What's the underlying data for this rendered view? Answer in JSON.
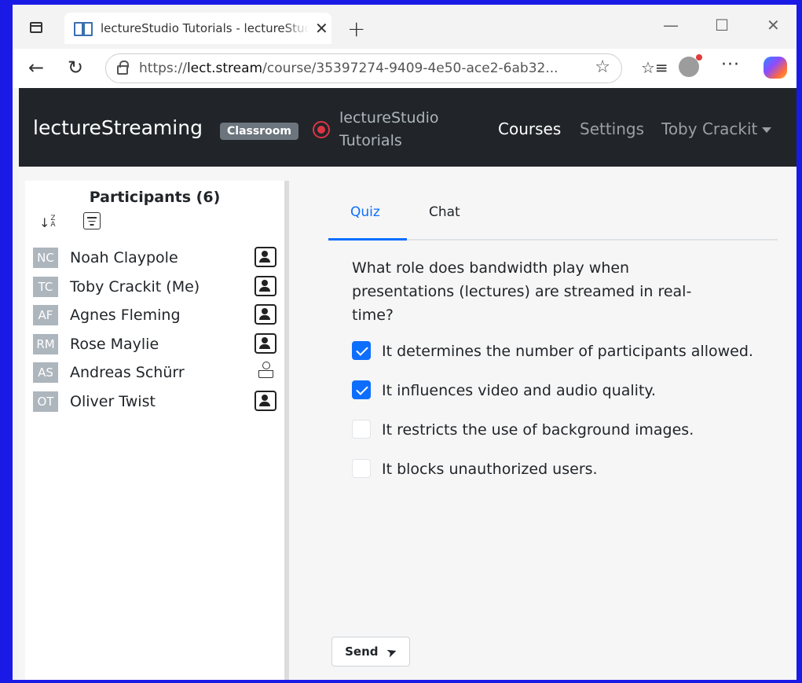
{
  "browser": {
    "tab_title": "lectureStudio Tutorials - lectureStudio",
    "url_prefix": "https://",
    "url_host": "lect.stream",
    "url_path": "/course/35397274-9409-4e50-ace2-6ab32...",
    "icons": [
      "tab-strip-icon",
      "book-icon",
      "close-icon",
      "plus-icon",
      "minimize-icon",
      "maximize-icon",
      "close-window-icon",
      "back-arrow-icon",
      "reload-icon",
      "lock-icon",
      "star-icon",
      "favorites-icon",
      "profile-icon",
      "more-icon",
      "copilot-icon"
    ]
  },
  "navbar": {
    "brand": "lectureStreaming",
    "badge": "Classroom",
    "course_title": "lectureStudio Tutorials",
    "links": {
      "courses": "Courses",
      "settings": "Settings",
      "user": "Toby Crackit"
    }
  },
  "participants": {
    "title": "Participants (6)",
    "items": [
      {
        "initials": "NC",
        "name": "Noah Claypole",
        "icon": "screen-share-icon"
      },
      {
        "initials": "TC",
        "name": "Toby Crackit (Me)",
        "icon": "screen-share-icon"
      },
      {
        "initials": "AF",
        "name": "Agnes Fleming",
        "icon": "screen-share-icon"
      },
      {
        "initials": "RM",
        "name": "Rose Maylie",
        "icon": "screen-share-icon"
      },
      {
        "initials": "AS",
        "name": "Andreas Schürr",
        "icon": "presenter-icon"
      },
      {
        "initials": "OT",
        "name": "Oliver Twist",
        "icon": "screen-share-icon"
      }
    ]
  },
  "quiz": {
    "tabs": {
      "quiz": "Quiz",
      "chat": "Chat"
    },
    "question": "What role does bandwidth play when presentations (lectures) are streamed in real-time?",
    "options": [
      {
        "label": "It determines the number of participants allowed.",
        "checked": true
      },
      {
        "label": "It influences video and audio quality.",
        "checked": true
      },
      {
        "label": "It restricts the use of background images.",
        "checked": false
      },
      {
        "label": "It blocks unauthorized users.",
        "checked": false
      }
    ],
    "send_label": "Send"
  },
  "colors": {
    "accent": "#0d6efd",
    "navbar": "#212529",
    "record": "#dc3545",
    "avatar": "#adb5bd",
    "frame": "#1a1ae6"
  }
}
